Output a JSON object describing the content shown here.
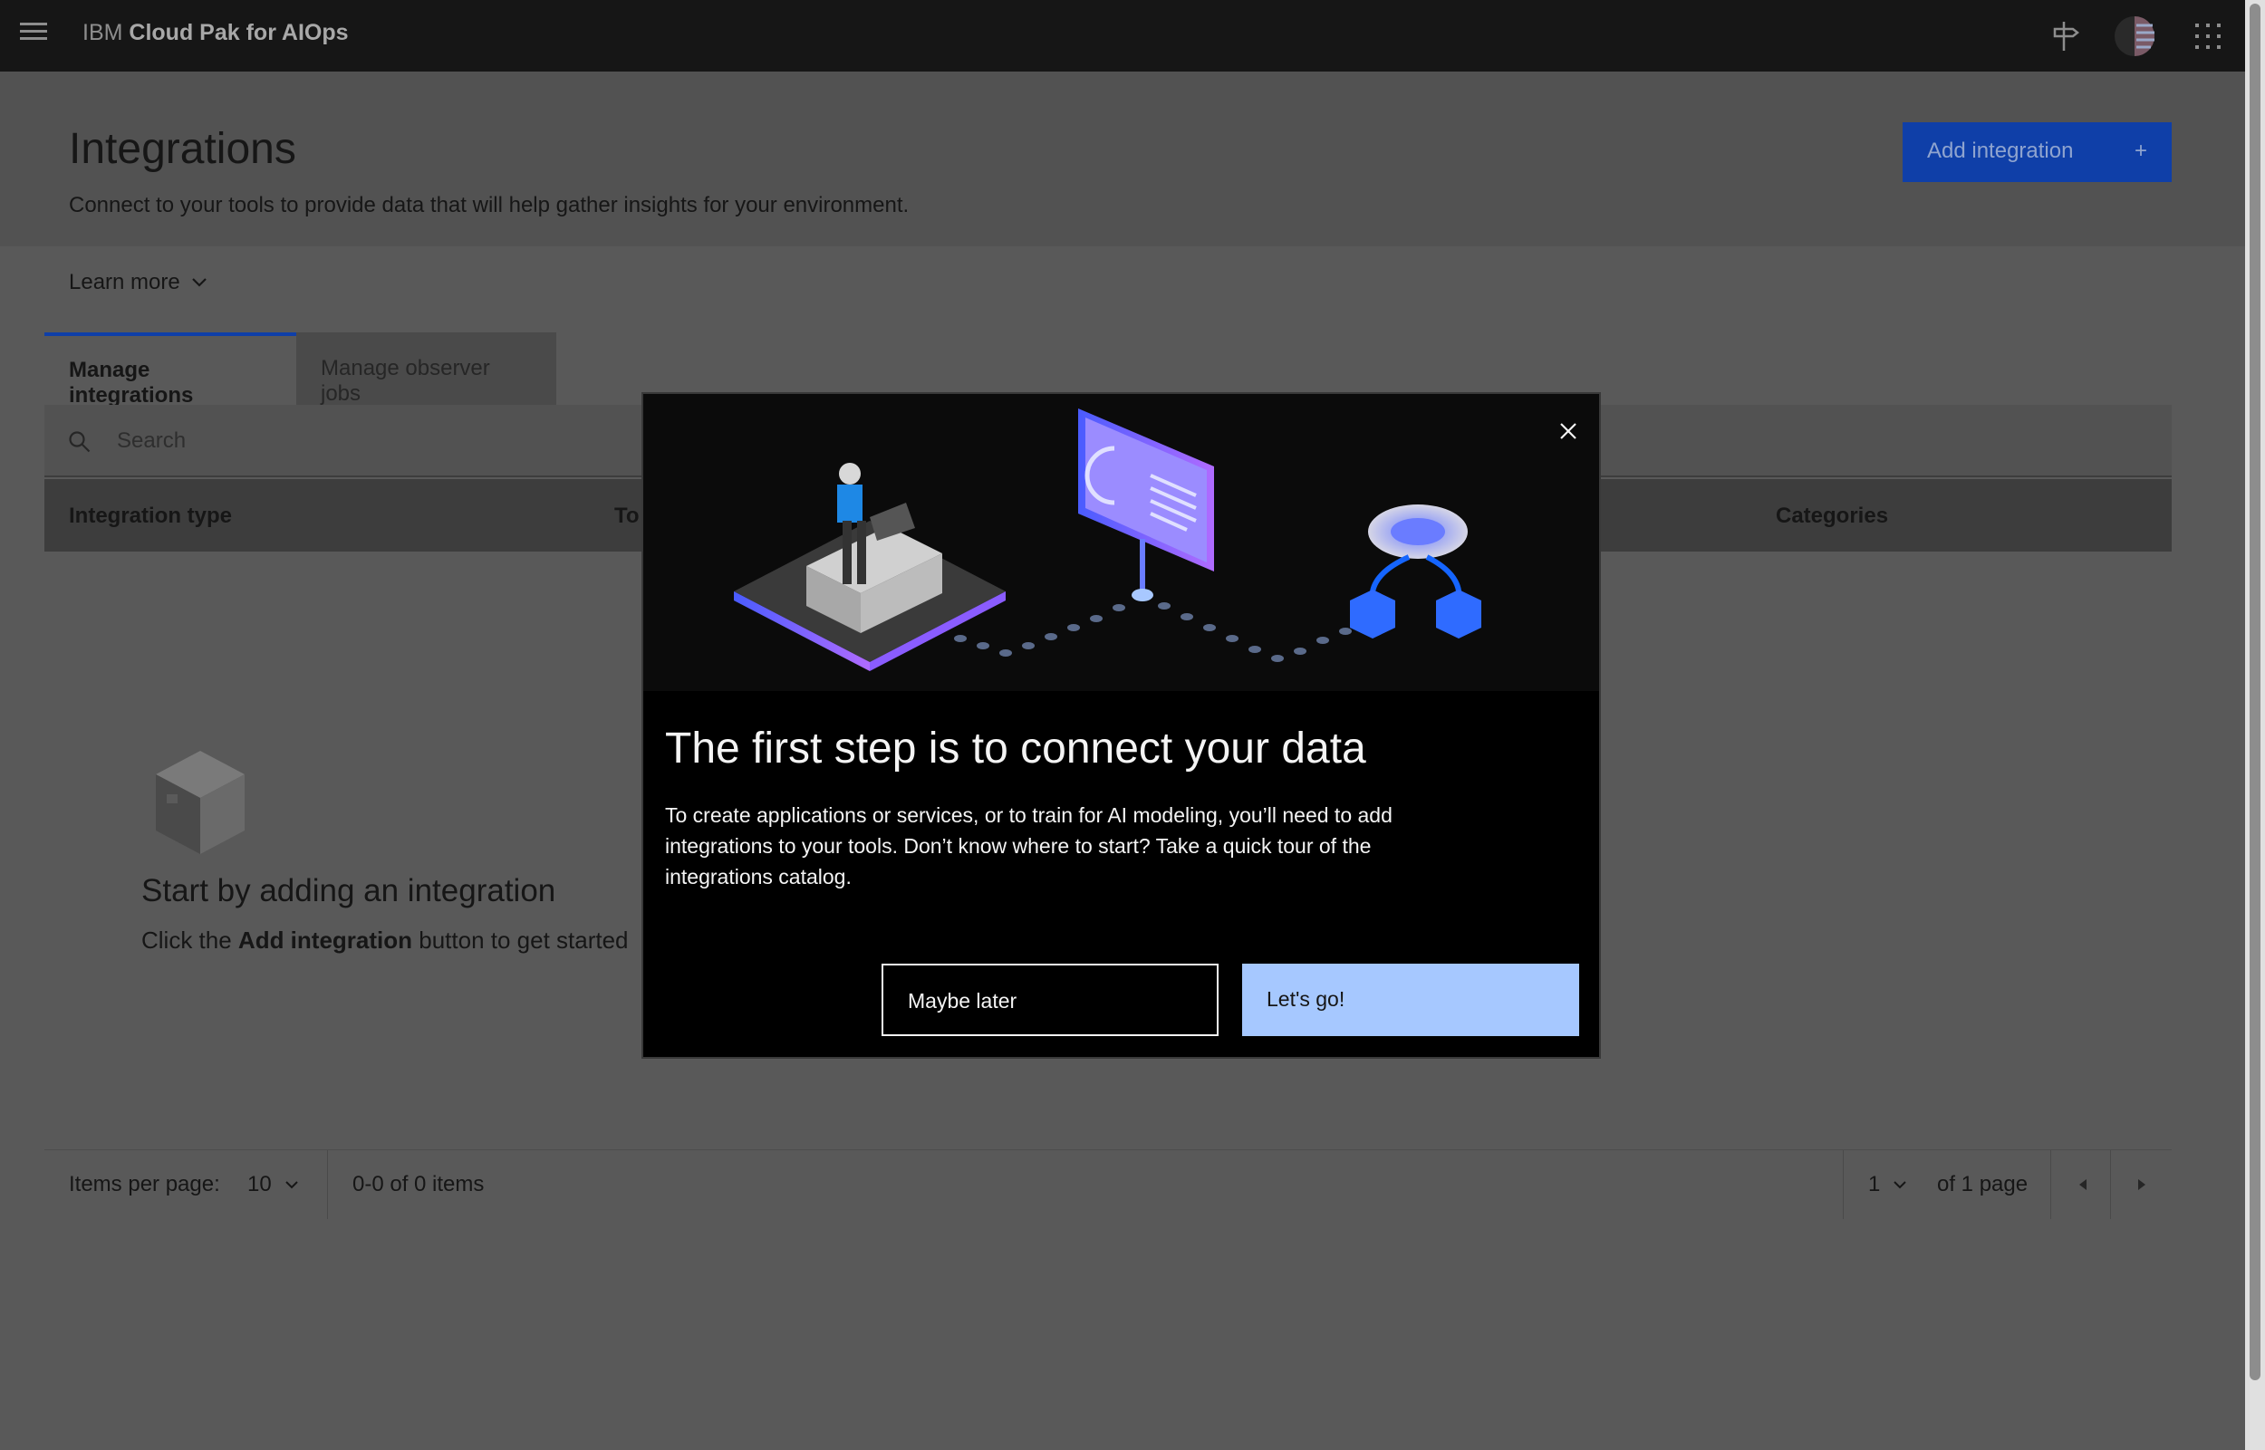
{
  "shell": {
    "brand_prefix": "IBM",
    "brand_product": "Cloud Pak for AIOps"
  },
  "page": {
    "title": "Integrations",
    "subtitle": "Connect to your tools to provide data that will help gather insights for your environment.",
    "add_button": "Add integration",
    "add_button_icon": "+",
    "learn_more": "Learn more"
  },
  "tabs": [
    {
      "label": "Manage integrations",
      "selected": true
    },
    {
      "label": "Manage observer jobs",
      "selected": false
    }
  ],
  "search": {
    "placeholder": "Search"
  },
  "table": {
    "columns": [
      "Integration type",
      "To",
      "Categories"
    ]
  },
  "empty": {
    "title": "Start by adding an integration",
    "sub_pre": "Click the ",
    "sub_bold": "Add integration",
    "sub_post": " button to get started"
  },
  "pager": {
    "items_per_page_label": "Items per page:",
    "items_per_page": "10",
    "range": "0-0 of 0 items",
    "page": "1",
    "of_pages": "of 1 page"
  },
  "modal": {
    "title": "The first step is to connect your data",
    "body": "To create applications or services, or to train for AI modeling, you’ll need to add integrations to your tools. Don’t know where to start? Take a quick tour of the integrations catalog.",
    "secondary": "Maybe later",
    "primary": "Let's go!"
  },
  "colors": {
    "accent": "#0f62fe",
    "primary_button": "#a6c8ff",
    "shell": "#161616"
  }
}
